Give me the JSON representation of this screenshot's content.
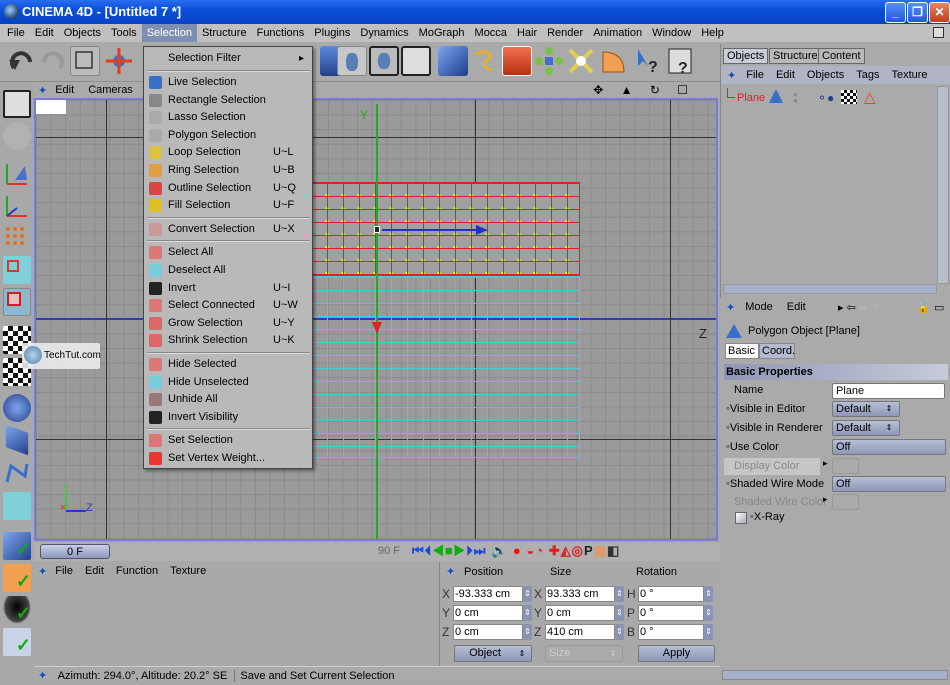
{
  "window": {
    "title": "CINEMA 4D - [Untitled 7 *]",
    "minimize": "_",
    "restore": "❐",
    "close": "✕"
  },
  "menubar": [
    "File",
    "Edit",
    "Objects",
    "Tools",
    "Selection",
    "Structure",
    "Functions",
    "Plugins",
    "Dynamics",
    "MoGraph",
    "Mocca",
    "Hair",
    "Render",
    "Animation",
    "Window",
    "Help"
  ],
  "menubar_active": "Selection",
  "viewport": {
    "menu": [
      "Edit",
      "Cameras"
    ],
    "axis_y": "Y",
    "axis_z": "Z",
    "nav_icons": [
      "move-view-icon",
      "zoom-view-icon",
      "rotate-view-icon",
      "maximize-view-icon"
    ],
    "watermark": "TechTut.com"
  },
  "selection_menu": {
    "items": [
      {
        "label": "Selection Filter",
        "shortcut": "",
        "submenu": true,
        "icon": ""
      },
      {
        "sep": true
      },
      {
        "label": "Live Selection",
        "shortcut": "",
        "icon": "live-selection-icon"
      },
      {
        "label": "Rectangle Selection",
        "shortcut": "",
        "icon": "rectangle-selection-icon"
      },
      {
        "label": "Lasso Selection",
        "shortcut": "",
        "icon": "lasso-selection-icon"
      },
      {
        "label": "Polygon Selection",
        "shortcut": "",
        "icon": "polygon-selection-icon"
      },
      {
        "label": "Loop Selection",
        "shortcut": "U~L",
        "icon": "loop-selection-icon"
      },
      {
        "label": "Ring Selection",
        "shortcut": "U~B",
        "icon": "ring-selection-icon"
      },
      {
        "label": "Outline Selection",
        "shortcut": "U~Q",
        "icon": "outline-selection-icon"
      },
      {
        "label": "Fill Selection",
        "shortcut": "U~F",
        "icon": "fill-selection-icon"
      },
      {
        "sep": true
      },
      {
        "label": "Convert Selection",
        "shortcut": "U~X",
        "icon": "convert-selection-icon"
      },
      {
        "sep": true
      },
      {
        "label": "Select All",
        "shortcut": "",
        "icon": "select-all-icon"
      },
      {
        "label": "Deselect All",
        "shortcut": "",
        "icon": "deselect-all-icon"
      },
      {
        "label": "Invert",
        "shortcut": "U~I",
        "icon": "invert-icon"
      },
      {
        "label": "Select Connected",
        "shortcut": "U~W",
        "icon": "select-connected-icon"
      },
      {
        "label": "Grow Selection",
        "shortcut": "U~Y",
        "icon": "grow-selection-icon"
      },
      {
        "label": "Shrink Selection",
        "shortcut": "U~K",
        "icon": "shrink-selection-icon"
      },
      {
        "sep": true
      },
      {
        "label": "Hide Selected",
        "shortcut": "",
        "icon": "hide-selected-icon"
      },
      {
        "label": "Hide Unselected",
        "shortcut": "",
        "icon": "hide-unselected-icon"
      },
      {
        "label": "Unhide All",
        "shortcut": "",
        "icon": "unhide-all-icon"
      },
      {
        "label": "Invert Visibility",
        "shortcut": "",
        "icon": "invert-visibility-icon"
      },
      {
        "sep": true
      },
      {
        "label": "Set Selection",
        "shortcut": "",
        "icon": "set-selection-icon"
      },
      {
        "label": "Set Vertex Weight...",
        "shortcut": "",
        "icon": "set-vertex-weight-icon"
      }
    ]
  },
  "object_manager": {
    "tabs": [
      "Objects",
      "Structure",
      "Content"
    ],
    "active_tab": "Objects",
    "menu": [
      "File",
      "Edit",
      "Objects",
      "Tags",
      "Texture"
    ],
    "objects": [
      {
        "name": "Plane",
        "color": "#e02020"
      }
    ]
  },
  "attributes": {
    "menu": [
      "Mode",
      "Edit"
    ],
    "object_title": "Polygon Object [Plane]",
    "tabs": [
      "Basic",
      "Coord."
    ],
    "active_tab": "Basic",
    "section": "Basic Properties",
    "rows": [
      {
        "label": "Name",
        "value": "Plane",
        "type": "text"
      },
      {
        "label": "Visible in Editor",
        "value": "Default",
        "type": "select"
      },
      {
        "label": "Visible in Renderer",
        "value": "Default",
        "type": "select"
      },
      {
        "label": "Use Color",
        "value": "Off",
        "type": "select"
      },
      {
        "label": "Display Color",
        "value": "",
        "type": "color",
        "disabled": true
      },
      {
        "label": "Shaded Wire Mode",
        "value": "Off",
        "type": "select"
      },
      {
        "label": "Shaded Wire Color",
        "value": "",
        "type": "color",
        "disabled": true
      },
      {
        "label": "X-Ray",
        "value": false,
        "type": "checkbox"
      }
    ]
  },
  "timeline": {
    "current_frame": "0 F",
    "end_frame": "90 F"
  },
  "material_manager": {
    "menu": [
      "File",
      "Edit",
      "Function",
      "Texture"
    ]
  },
  "coordinates": {
    "headers": [
      "Position",
      "Size",
      "Rotation"
    ],
    "position": {
      "X": "-93.333 cm",
      "Y": "0 cm",
      "Z": "0 cm"
    },
    "size": {
      "X": "93.333 cm",
      "Y": "0 cm",
      "Z": "410 cm"
    },
    "rotation": {
      "H": "0 °",
      "P": "0 °",
      "B": "0 °"
    },
    "mode_select": "Object",
    "size_select": "Size",
    "apply": "Apply"
  },
  "status": {
    "left": "Azimuth: 294.0°, Altitude: 20.2°  SE",
    "right": "Save and Set Current Selection"
  }
}
